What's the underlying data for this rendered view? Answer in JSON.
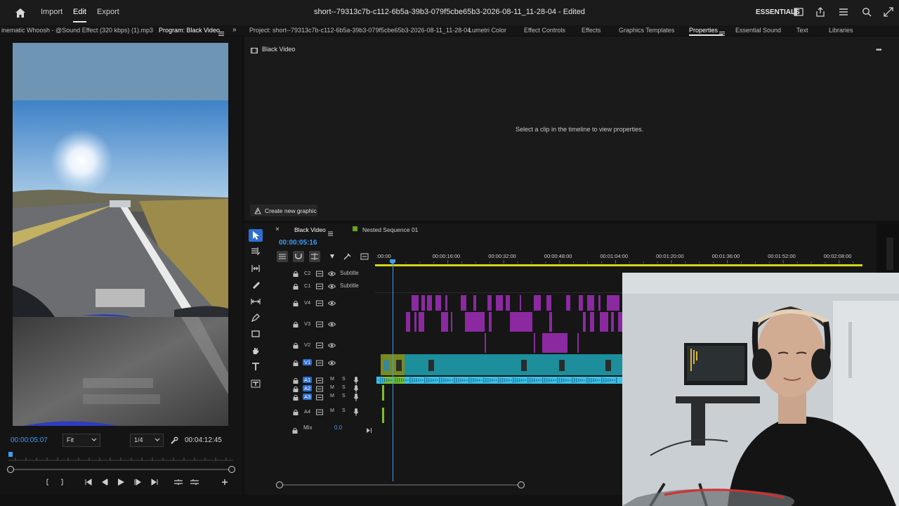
{
  "topbar": {
    "home_icon": "home-icon",
    "menu": [
      "Import",
      "Edit",
      "Export"
    ],
    "active_menu": "Edit",
    "title": "short--79313c7b-c112-6b5a-39b3-079f5cbe65b3-2026-08-11_11-28-04 - Edited",
    "workspace": "ESSENTIALS",
    "icons": [
      "quick-export-icon",
      "share-icon",
      "panel-menu-icon",
      "search-icon",
      "fullscreen-icon"
    ]
  },
  "tabs": {
    "source_clip": "inematic Whoosh - @Sound Effect (320 kbps) (1).mp3",
    "program": "Program: Black Video",
    "project": "Project: short--79313c7b-c112-6b5a-39b3-079f5cbe65b3-2026-08-11_11-28-04",
    "right_tabs": [
      "Lumetri Color",
      "Effect Controls",
      "Effects",
      "Graphics Templates",
      "Properties",
      "Essential Sound",
      "Text",
      "Libraries"
    ],
    "active_right_tab": "Properties"
  },
  "properties": {
    "heading": "Black Video",
    "empty_message": "Select a clip in the timeline to view properties.",
    "create_graphic_label": "Create new graphic"
  },
  "program": {
    "timecode": "00:00:05:07",
    "fit": "Fit",
    "resolution": "1/4",
    "duration": "00:04:12:45",
    "playhead_fraction": 0.0
  },
  "timeline": {
    "sequence_tabs": [
      "Black Video",
      "Nested Sequence 01"
    ],
    "active_sequence": "Black Video",
    "timecode": "00:00:05:16",
    "ruler": [
      ":00:00",
      "00:00:16:00",
      "00:00:32:00",
      "00:00:48:00",
      "00:01:04:00",
      "00:01:20:00",
      "00:01:36:00",
      "00:01:52:00",
      "00:02:08:00"
    ],
    "tracks": [
      {
        "id": "C2",
        "name": "Subtitle"
      },
      {
        "id": "C1",
        "name": "Subtitle"
      },
      {
        "id": "V4",
        "name": ""
      },
      {
        "id": "V3",
        "name": ""
      },
      {
        "id": "V2",
        "name": ""
      },
      {
        "id": "V1",
        "name": ""
      },
      {
        "id": "A1",
        "name": ""
      },
      {
        "id": "A2",
        "name": ""
      },
      {
        "id": "A3",
        "name": ""
      },
      {
        "id": "A4",
        "name": ""
      }
    ],
    "mix_label": "Mix",
    "mix_value": "0.0",
    "track_buttons": [
      "M",
      "S"
    ]
  },
  "tools": [
    "selection-tool-icon",
    "track-select-icon",
    "ripple-edit-icon",
    "razor-icon",
    "slip-icon",
    "pen-icon",
    "rectangle-icon",
    "hand-icon",
    "type-icon",
    "caption-tool-icon"
  ],
  "colors": {
    "accent_blue": "#2d8ceb",
    "clip_teal": "#1c8e9c",
    "clip_magenta": "#8b2aa0",
    "audio_cyan": "#3cc0e6",
    "clip_green": "#7bbf2a"
  }
}
